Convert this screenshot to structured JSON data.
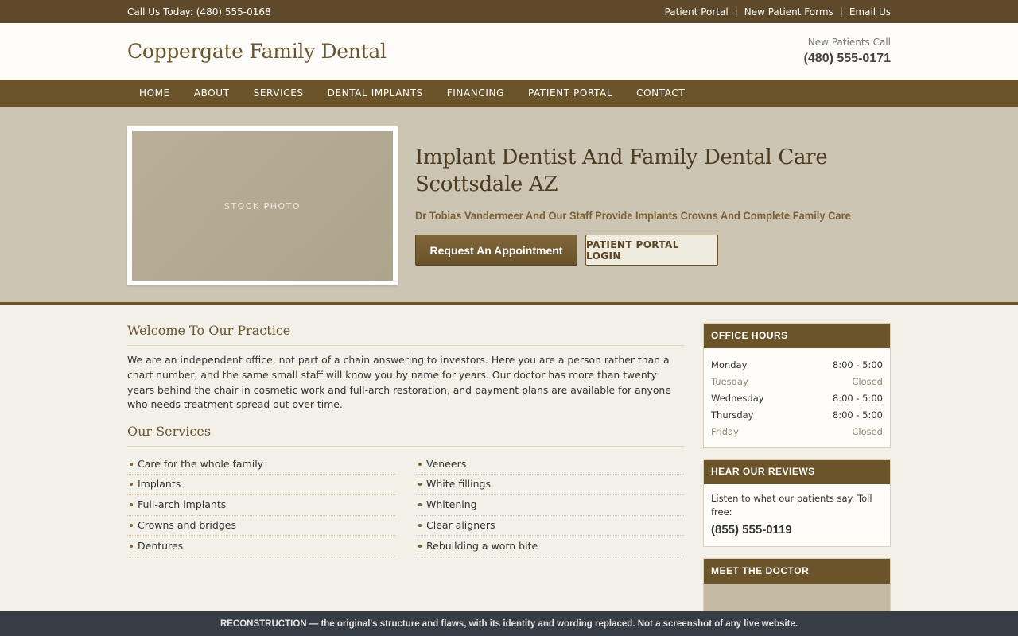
{
  "topbar": {
    "call_text": "Call Us Today: (480) 555-0168",
    "links": [
      "Patient Portal",
      "New Patient Forms",
      "Email Us"
    ],
    "separator": "|"
  },
  "header": {
    "logo": "Coppergate Family Dental",
    "new_patients_label": "New Patients Call",
    "new_patients_phone": "(480) 555-0171"
  },
  "nav": [
    "HOME",
    "ABOUT",
    "SERVICES",
    "DENTAL IMPLANTS",
    "FINANCING",
    "PATIENT PORTAL",
    "CONTACT"
  ],
  "hero": {
    "photo_label": "STOCK PHOTO",
    "title": "Implant Dentist And Family Dental Care Scottsdale AZ",
    "subtitle": "Dr Tobias Vandermeer And Our Staff Provide Implants Crowns And Complete Family Care",
    "primary_button": "Request An Appointment",
    "secondary_button": "PATIENT PORTAL LOGIN"
  },
  "main": {
    "welcome_title": "Welcome To Our Practice",
    "welcome_text": "We are an independent office, not part of a chain answering to investors. Here you are a person rather than a chart number, and the same small staff will know you by name for years. Our doctor has more than twenty years behind the chair in cosmetic work and full-arch restoration, and payment plans are available for anyone who needs treatment spread out over time.",
    "services_title": "Our Services",
    "services_left": [
      "Care for the whole family",
      "Implants",
      "Full-arch implants",
      "Crowns and bridges",
      "Dentures"
    ],
    "services_right": [
      "Veneers",
      "White fillings",
      "Whitening",
      "Clear aligners",
      "Rebuilding a worn bite"
    ]
  },
  "sidebar": {
    "hours_title": "OFFICE HOURS",
    "hours": [
      {
        "day": "Monday",
        "time": "8:00 - 5:00",
        "closed": false
      },
      {
        "day": "Tuesday",
        "time": "Closed",
        "closed": true
      },
      {
        "day": "Wednesday",
        "time": "8:00 - 5:00",
        "closed": false
      },
      {
        "day": "Thursday",
        "time": "8:00 - 5:00",
        "closed": false
      },
      {
        "day": "Friday",
        "time": "Closed",
        "closed": true
      }
    ],
    "reviews_title": "HEAR OUR REVIEWS",
    "reviews_text": "Listen to what our patients say. Toll free:",
    "reviews_phone": "(855) 555-0119",
    "doctor_title": "MEET THE DOCTOR"
  },
  "footer_strip": "RECONSTRUCTION — the original's structure and flaws, with its identity and wording replaced. Not a screenshot of any live website.",
  "colors": {
    "brand_brown": "#6b5429",
    "topbar": "#5e4a2a",
    "hero_bg": "#cdc5b3",
    "page_bg": "#f3f0e8",
    "strip_bg": "#373d45"
  }
}
